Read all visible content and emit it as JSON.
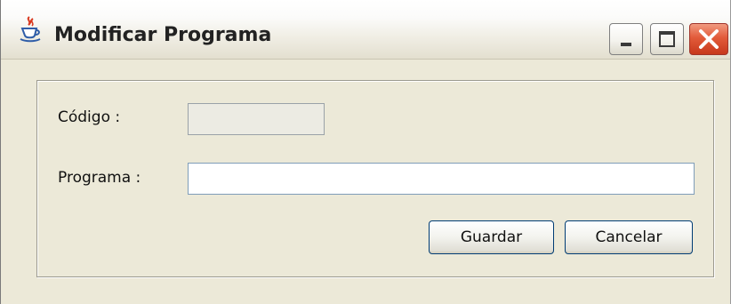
{
  "window": {
    "title": "Modificar Programa",
    "app_icon": "java-coffee-cup-icon",
    "controls": {
      "minimize_icon": "minimize-icon",
      "maximize_icon": "maximize-icon",
      "close_icon": "close-icon"
    },
    "colors": {
      "close_button": "#e25b3a",
      "window_background": "#ece9d8"
    }
  },
  "form": {
    "codigo": {
      "label": "Código :",
      "value": "",
      "placeholder": "",
      "editable": false
    },
    "programa": {
      "label": "Programa :",
      "value": "",
      "placeholder": ""
    }
  },
  "actions": {
    "save_label": "Guardar",
    "cancel_label": "Cancelar"
  }
}
